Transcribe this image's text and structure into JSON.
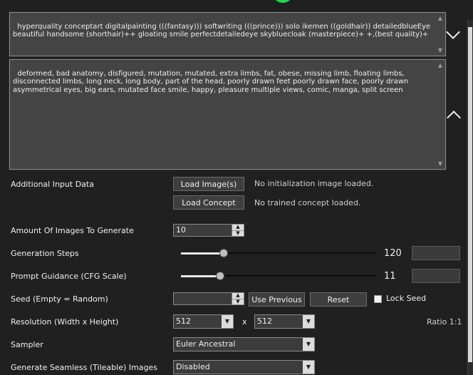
{
  "prompt": {
    "positive": "hyperquality conceptart digitalpainting (((fantasy))) softwriting (((prince))) solo ikemen ((goldhair)) detailedblueEye beautiful handsome (shorthair)++ gloating smile perfectdetailedeye skybluecloak (masterpiece)+ +,(best quality)+",
    "negative": "deformed, bad anatomy, disfigured, mutation, mutated, extra limbs, fat, obese, missing limb, floating limbs, disconnected limbs, long neck, long body, part of the head, poorly drawn feet poorly drawn face, poorly drawn asymmetrical eyes, big ears, mutated face smile, happy, pleasure multiple views, comic, manga, split screen"
  },
  "additional_input": {
    "label": "Additional Input Data",
    "load_image_label": "Load Image(s)",
    "image_status": "No initialization image loaded.",
    "load_concept_label": "Load Concept",
    "concept_status": "No trained concept loaded."
  },
  "amount": {
    "label": "Amount Of Images To Generate",
    "value": "10"
  },
  "steps": {
    "label": "Generation Steps",
    "value": "120",
    "fraction": 0.22
  },
  "guidance": {
    "label": "Prompt Guidance (CFG Scale)",
    "value": "11",
    "fraction": 0.2
  },
  "seed": {
    "label": "Seed (Empty = Random)",
    "value": "",
    "use_previous_label": "Use Previous",
    "reset_label": "Reset",
    "lock_label": "Lock Seed"
  },
  "resolution": {
    "label": "Resolution (Width x Height)",
    "width": "512",
    "separator": "x",
    "height": "512",
    "ratio": "Ratio 1:1"
  },
  "sampler": {
    "label": "Sampler",
    "value": "Euler Ancestral"
  },
  "seamless": {
    "label": "Generate Seamless (Tileable) Images",
    "value": "Disabled"
  }
}
